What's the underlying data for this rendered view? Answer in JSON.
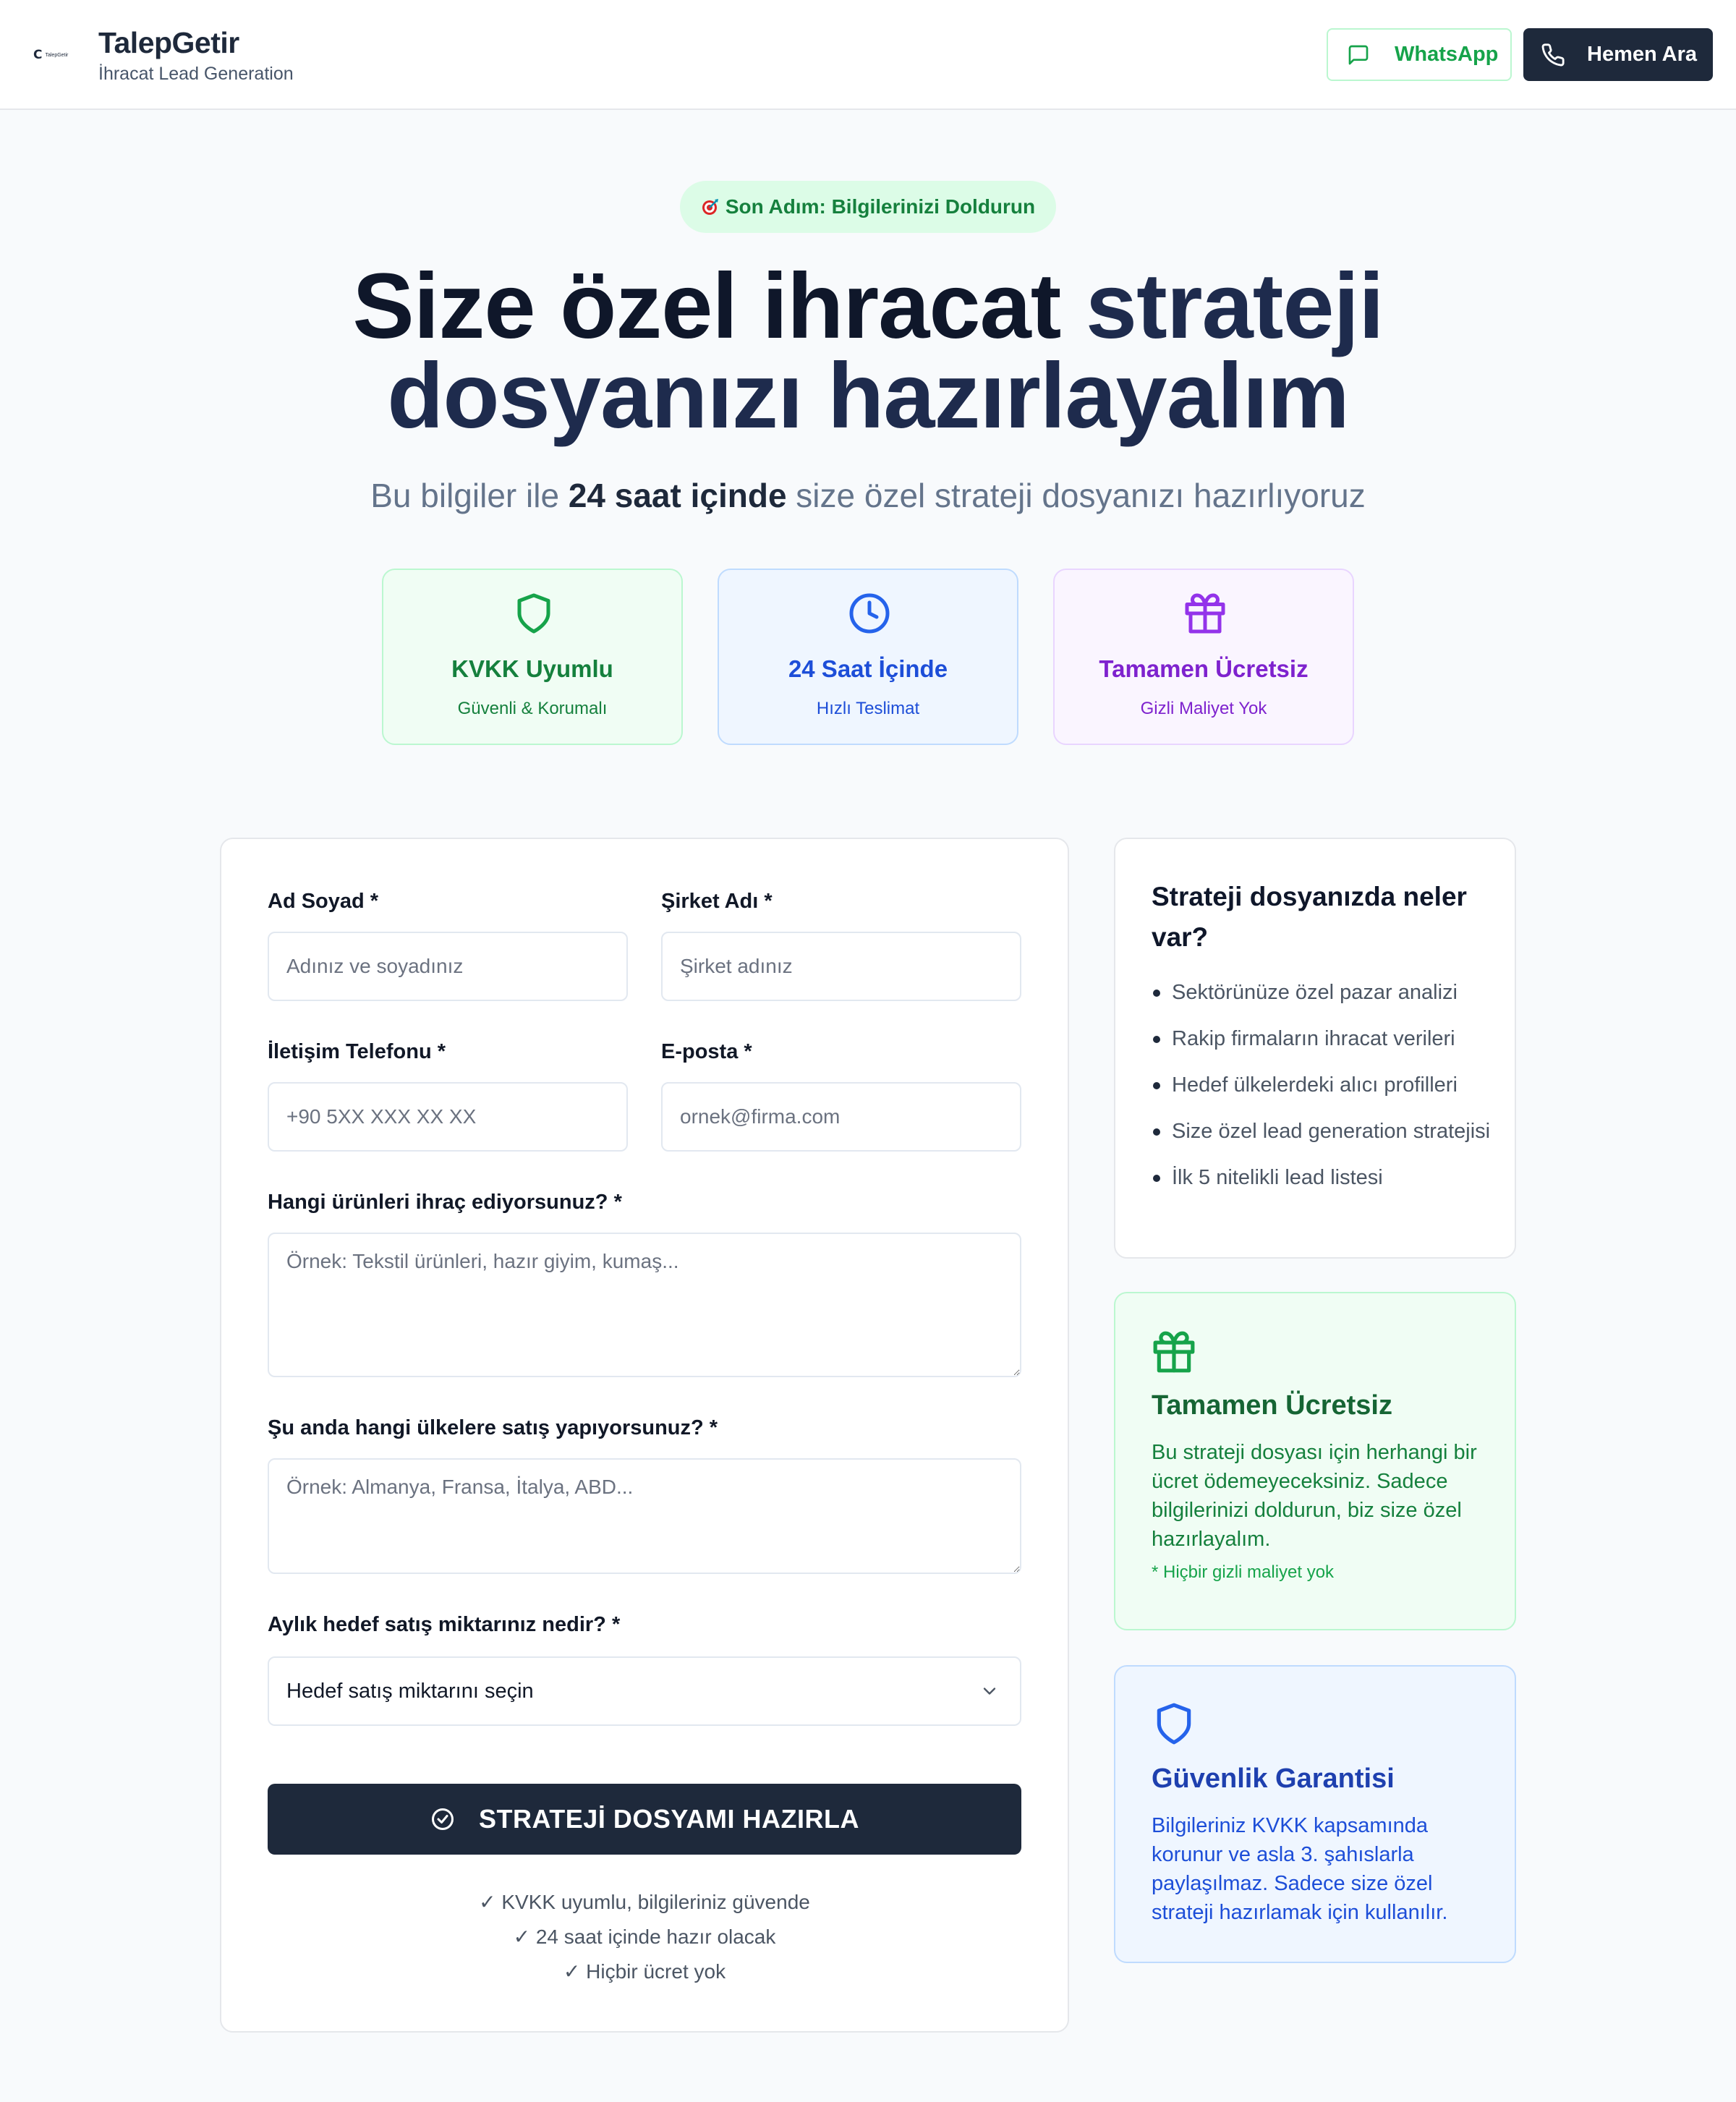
{
  "header": {
    "logo_text": "TalepGetir",
    "brand_title": "TalepGetir",
    "brand_subtitle": "İhracat Lead Generation",
    "whatsapp_label": "WhatsApp",
    "call_label": "Hemen Ara",
    "icons": {
      "whatsapp": "message-square-icon",
      "call": "phone-icon"
    }
  },
  "hero": {
    "badge": "Son Adım: Bilgilerinizi Doldurun",
    "title_part1": "Size özel ihracat ",
    "title_accent": "strateji",
    "title_part2": "dosyanızı hazırlayalım",
    "subtitle_pre": "Bu bilgiler ile ",
    "subtitle_bold": "24 saat içinde",
    "subtitle_post": " size özel strateji dosyanızı hazırlıyoruz"
  },
  "features": [
    {
      "title": "KVKK Uyumlu",
      "subtitle": "Güvenli & Korumalı",
      "icon": "shield-icon",
      "color": "#15803d"
    },
    {
      "title": "24 Saat İçinde",
      "subtitle": "Hızlı Teslimat",
      "icon": "clock-icon",
      "color": "#2563eb"
    },
    {
      "title": "Tamamen Ücretsiz",
      "subtitle": "Gizli Maliyet Yok",
      "icon": "gift-icon",
      "color": "#9333ea"
    }
  ],
  "form": {
    "name": {
      "label": "Ad Soyad *",
      "placeholder": "Adınız ve soyadınız",
      "value": ""
    },
    "company": {
      "label": "Şirket Adı *",
      "placeholder": "Şirket adınız",
      "value": ""
    },
    "phone": {
      "label": "İletişim Telefonu *",
      "placeholder": "+90 5XX XXX XX XX",
      "value": ""
    },
    "email": {
      "label": "E-posta *",
      "placeholder": "ornek@firma.com",
      "value": ""
    },
    "products": {
      "label": "Hangi ürünleri ihraç ediyorsunuz? *",
      "placeholder": "Örnek: Tekstil ürünleri, hazır giyim, kumaş...",
      "value": ""
    },
    "countries": {
      "label": "Şu anda hangi ülkelere satış yapıyorsunuz? *",
      "placeholder": "Örnek: Almanya, Fransa, İtalya, ABD...",
      "value": ""
    },
    "target": {
      "label": "Aylık hedef satış miktarınız nedir? *",
      "selected": "Hedef satış miktarını seçin"
    },
    "submit_label": "STRATEJİ DOSYAMI HAZIRLA",
    "notes": [
      "✓ KVKK uyumlu, bilgileriniz güvende",
      "✓ 24 saat içinde hazır olacak",
      "✓ Hiçbir ücret yok"
    ]
  },
  "sidebar": {
    "contents": {
      "title": "Strateji dosyanızda neler var?",
      "items": [
        "Sektörünüze özel pazar analizi",
        "Rakip firmaların ihracat verileri",
        "Hedef ülkelerdeki alıcı profilleri",
        "Size özel lead generation stratejisi",
        "İlk 5 nitelikli lead listesi"
      ]
    },
    "free": {
      "title": "Tamamen Ücretsiz",
      "description": "Bu strateji dosyası için herhangi bir ücret ödemeyeceksiniz. Sadece bilgilerinizi doldurun, biz size özel hazırlayalım.",
      "note": "* Hiçbir gizli maliyet yok"
    },
    "security": {
      "title": "Güvenlik Garantisi",
      "description": "Bilgileriniz KVKK kapsamında korunur ve asla 3. şahıslarla paylaşılmaz. Sadece size özel strateji hazırlamak için kullanılır."
    }
  }
}
